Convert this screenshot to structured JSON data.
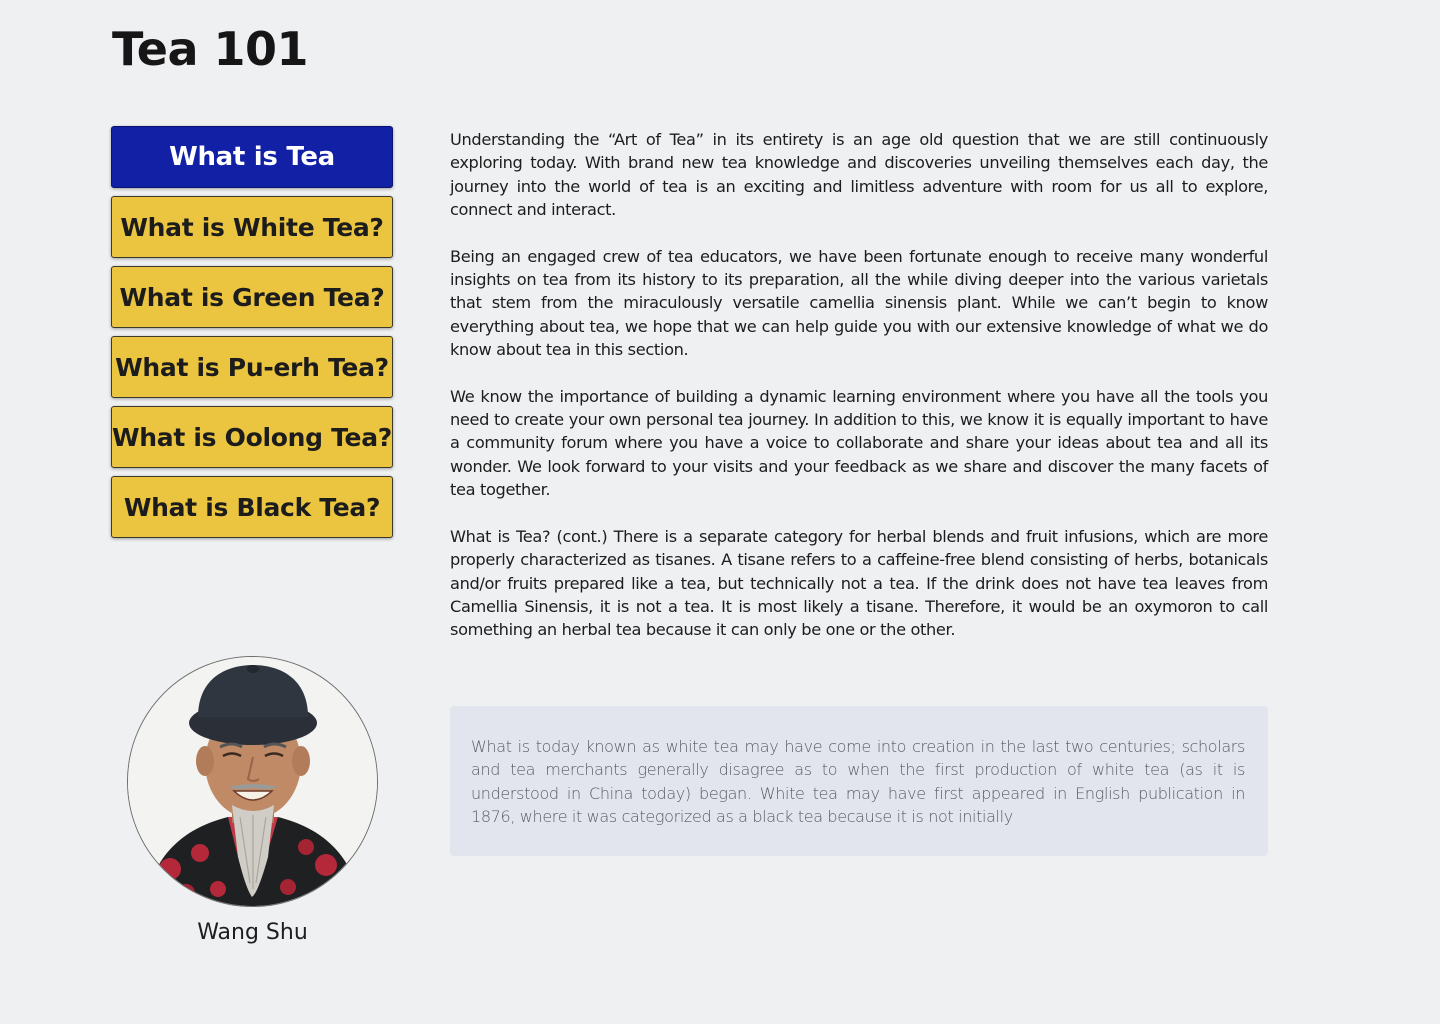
{
  "page": {
    "title": "Tea 101"
  },
  "nav": {
    "items": [
      {
        "label": "What is Tea",
        "active": true
      },
      {
        "label": "What is White Tea?",
        "active": false
      },
      {
        "label": "What is Green Tea?",
        "active": false
      },
      {
        "label": "What is Pu-erh Tea?",
        "active": false
      },
      {
        "label": "What is Oolong Tea?",
        "active": false
      },
      {
        "label": "What is Black Tea?",
        "active": false
      }
    ]
  },
  "article": {
    "paragraphs": [
      "Understanding the “Art of Tea” in its entirety is an age old question that we are still continuously exploring today. With brand new tea knowledge and discoveries unveiling themselves each day, the journey into the world of tea is an exciting and limitless adventure with room for us all to explore, connect and interact.",
      "Being an engaged crew of tea educators, we have been fortunate enough to receive many wonderful insights on tea from its history to its preparation, all the while diving deeper into the various varietals that stem from the miraculously versatile camellia sinensis plant. While we can’t begin to know everything about tea, we hope that we can help guide you with our extensive knowledge of what we do know about tea in this section.",
      "We know the importance of building a dynamic learning environment where you have all the tools you need to create your own personal tea journey. In addition to this, we know it is equally important to have a community forum where you have a voice to collaborate and share your ideas about tea and all its wonder. We look forward to your visits and your feedback as we share and discover the many facets of tea together.",
      "What is Tea? (cont.) There is a separate category for herbal blends and fruit infusions, which are more properly characterized as tisanes. A tisane refers to a caffeine-free blend consisting of herbs, botanicals and/or fruits prepared like a tea, but technically not a tea. If the drink does not have tea leaves from Camellia Sinensis, it is not a tea. It is most likely a tisane. Therefore, it would be an oxymoron to call something an herbal tea because it can only be one or the other."
    ]
  },
  "quote": {
    "text": "What is today known as white tea may have come into creation in the last two centuries; scholars and tea merchants generally disagree as to when the first production of white tea (as it is understood in China today) began. White tea may have first appeared in English publication in 1876, where it was categorized as a black tea because it is not initially"
  },
  "profile": {
    "name": "Wang Shu"
  },
  "colors": {
    "active_button": "#1220a6",
    "button": "#ebc53f",
    "background": "#eff0f2",
    "quote_background": "#e3e5ee"
  }
}
